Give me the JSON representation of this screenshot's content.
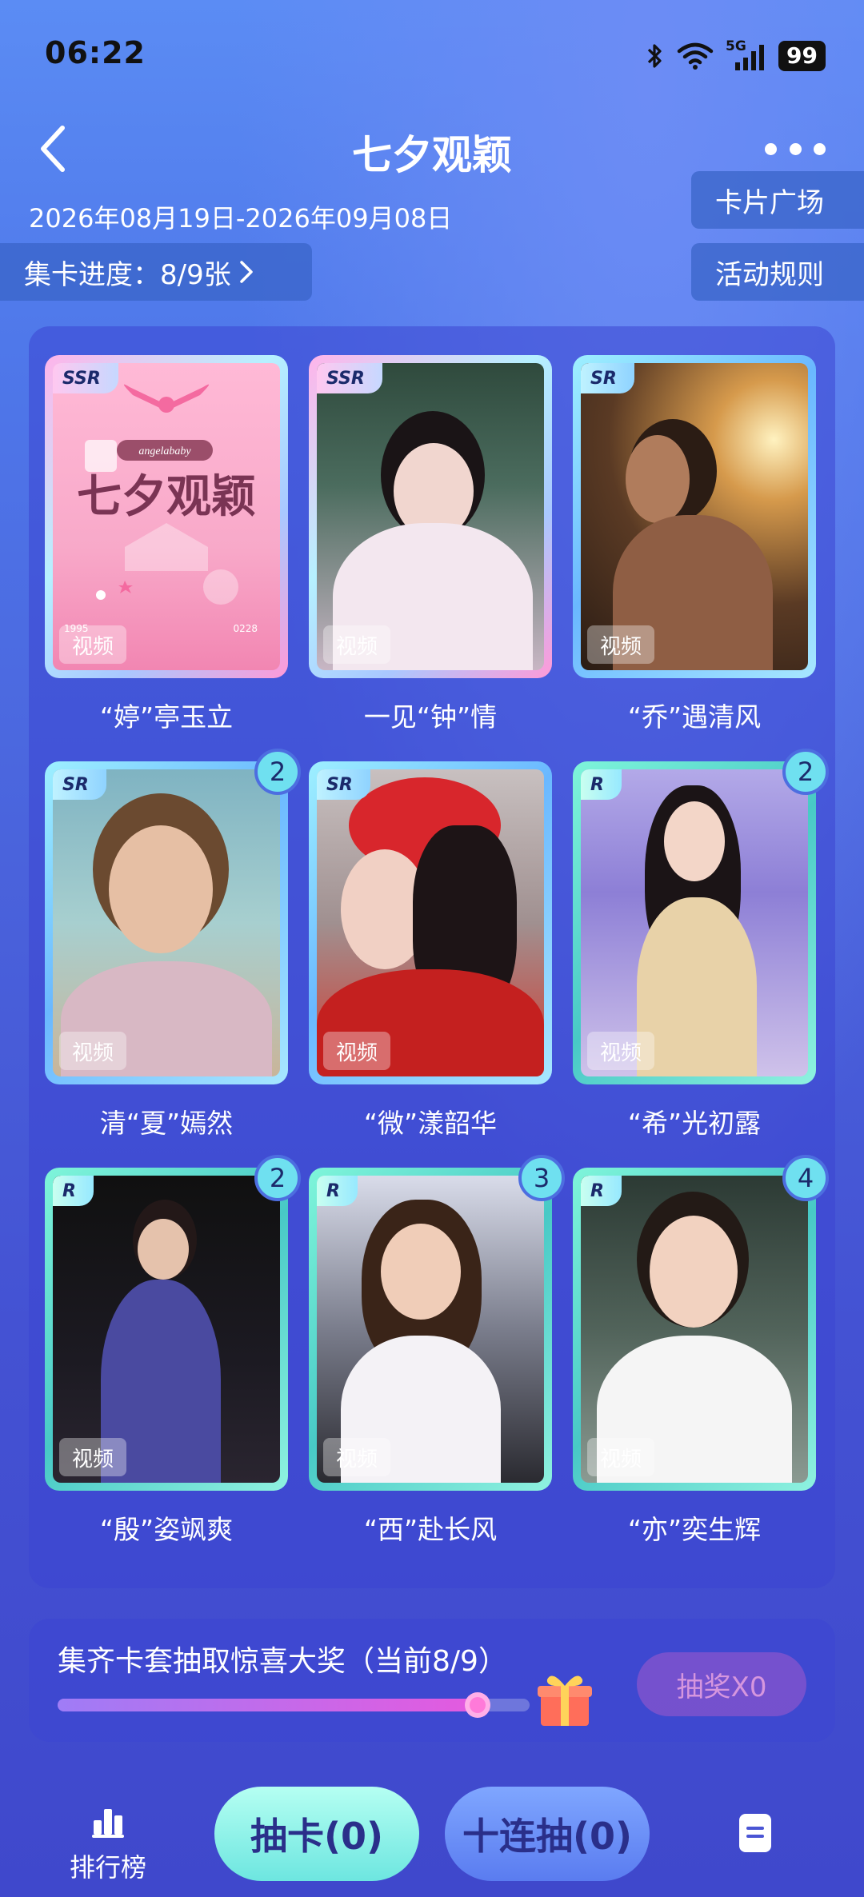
{
  "status_bar": {
    "time": "06:22",
    "network": "5G",
    "battery": "99"
  },
  "header": {
    "title": "七夕观颖",
    "date_range": "2026年08月19日-2026年09月08日",
    "progress_label": "集卡进度：8/9张",
    "card_square_label": "卡片广场",
    "rules_label": "活动规则"
  },
  "cards": [
    {
      "rarity": "SSR",
      "tag": "视频",
      "caption": "“婷”亭玉立",
      "count": ""
    },
    {
      "rarity": "SSR",
      "tag": "视频",
      "caption": "一见“钟”情",
      "count": ""
    },
    {
      "rarity": "SR",
      "tag": "视频",
      "caption": "“乔”遇清风",
      "count": ""
    },
    {
      "rarity": "SR",
      "tag": "视频",
      "caption": "清“夏”嫣然",
      "count": "2"
    },
    {
      "rarity": "SR",
      "tag": "视频",
      "caption": "“微”漾韶华",
      "count": ""
    },
    {
      "rarity": "R",
      "tag": "视频",
      "caption": "“希”光初露",
      "count": "2"
    },
    {
      "rarity": "R",
      "tag": "视频",
      "caption": "“殷”姿飒爽",
      "count": "2"
    },
    {
      "rarity": "R",
      "tag": "视频",
      "caption": "“西”赴长风",
      "count": "3"
    },
    {
      "rarity": "R",
      "tag": "视频",
      "caption": "“亦”奕生辉",
      "count": "4"
    }
  ],
  "card1_art": {
    "brand": "angelababy",
    "title": "七夕观颖",
    "left_tag": "1995",
    "right_tag": "0228"
  },
  "lottery": {
    "title": "集齐卡套抽取惊喜大奖（当前8/9）",
    "progress": 0.889,
    "draw_label": "抽奖X0"
  },
  "bottom_bar": {
    "rank_label": "排行榜",
    "draw_card_label": "抽卡(0)",
    "ten_draw_label": "十连抽(0)"
  }
}
